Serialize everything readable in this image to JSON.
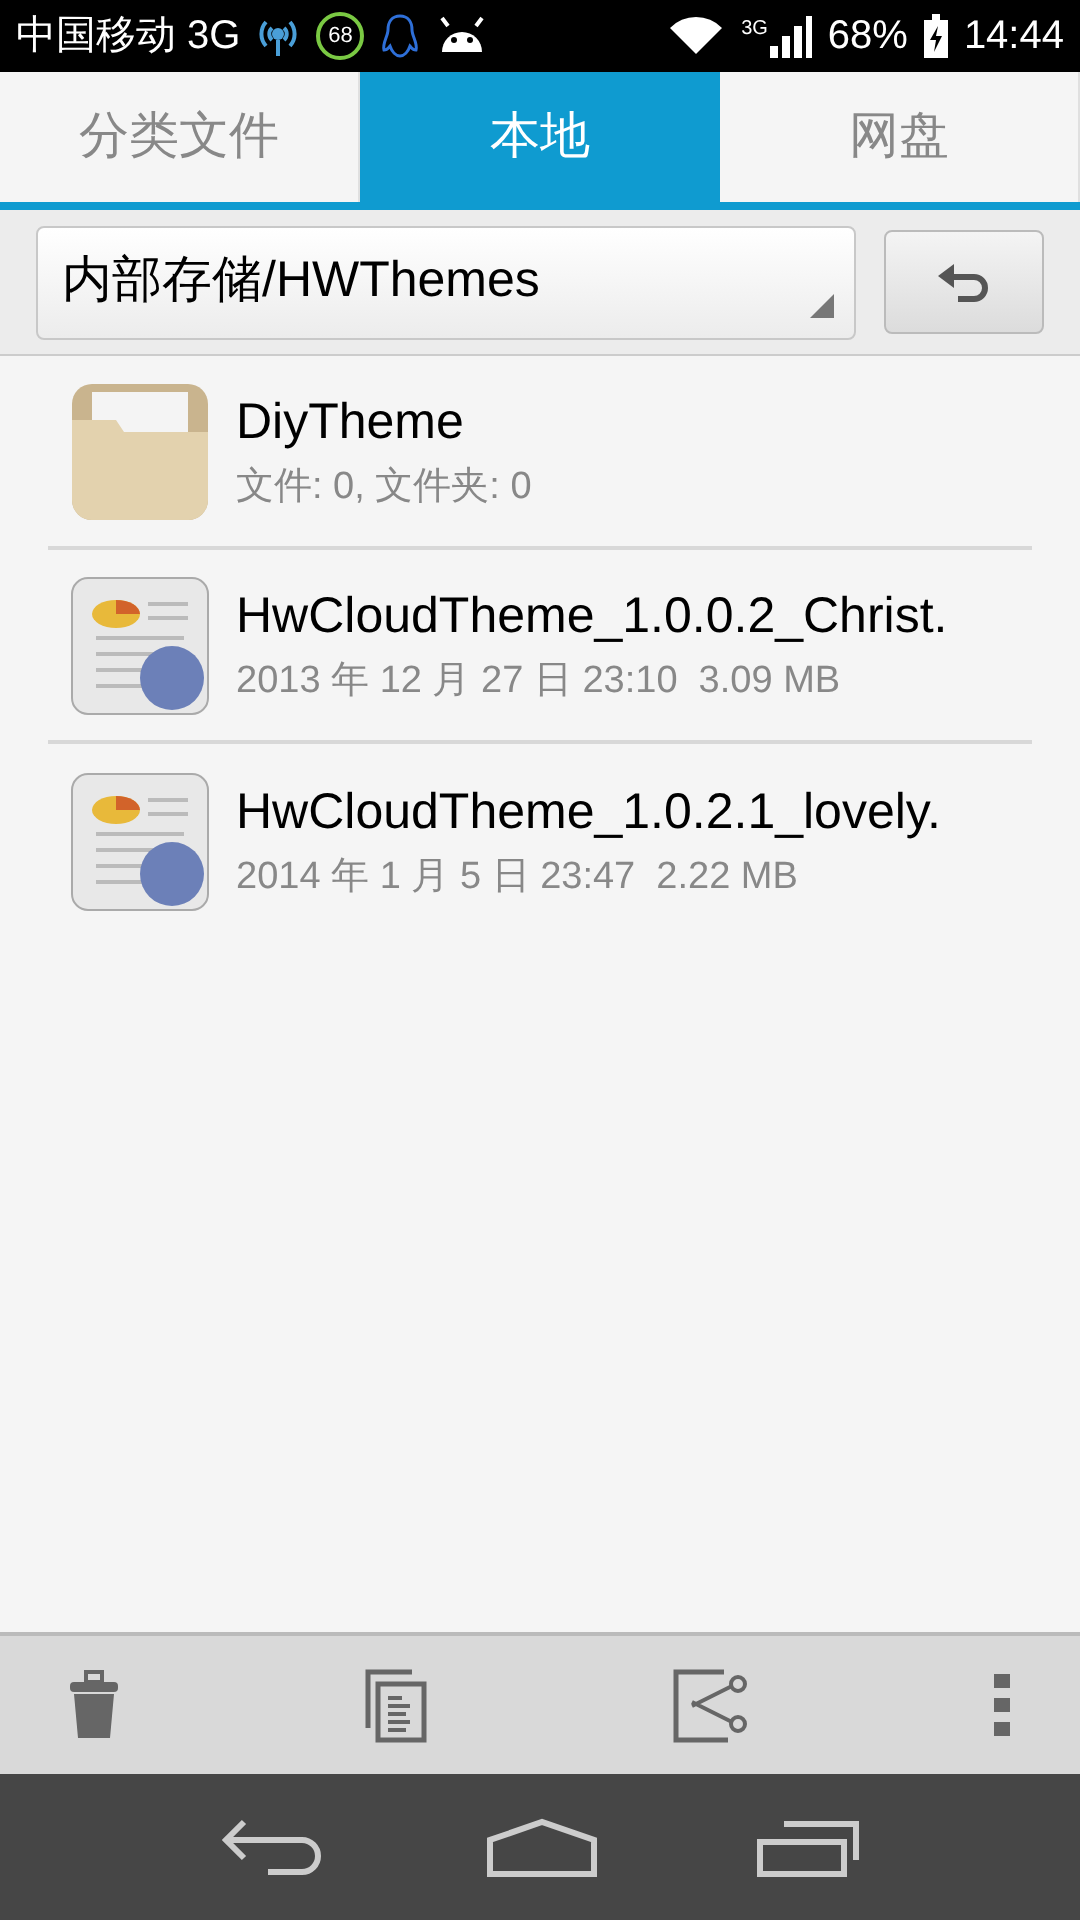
{
  "status_bar": {
    "carrier": "中国移动 3G",
    "badge": "68",
    "network": "3G",
    "battery": "68%",
    "time": "14:44"
  },
  "tabs": [
    {
      "label": "分类文件",
      "selected": false
    },
    {
      "label": "本地",
      "selected": true
    },
    {
      "label": "网盘",
      "selected": false
    }
  ],
  "path": {
    "value": "内部存储/HWThemes"
  },
  "files": [
    {
      "kind": "folder",
      "name": "DiyTheme",
      "details": "文件: 0, 文件夹: 0"
    },
    {
      "kind": "file",
      "name": "HwCloudTheme_1.0.0.2_Christ.",
      "details": "2013 年 12 月 27 日 23:10  3.09 MB"
    },
    {
      "kind": "file",
      "name": "HwCloudTheme_1.0.2.1_lovely.",
      "details": "2014 年 1 月 5 日 23:47  2.22 MB"
    }
  ]
}
